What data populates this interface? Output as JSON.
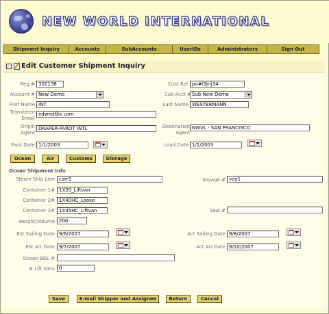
{
  "header": {
    "company_name": "NEW WORLD INTERNATIONAL"
  },
  "nav": [
    {
      "label": "Shipment Inquiry"
    },
    {
      "label": "Accounts"
    },
    {
      "label": "SubAccounts"
    },
    {
      "label": "UserIDs"
    },
    {
      "label": "Administrators"
    },
    {
      "label": "Sign Out"
    }
  ],
  "panel": {
    "collapse_symbol": "–",
    "title": "Edit Customer Shipment Inquiry"
  },
  "form": {
    "reg_label": "Reg #",
    "reg_value": "302138",
    "cust_ref_label": "Cust Ref #",
    "cust_ref_value": "po#i3jrij34",
    "account_label": "Account #",
    "account_value": "New Demo",
    "sub_acct_label": "Sub Acct #",
    "sub_acct_value": "Sub New Demo",
    "first_name_label": "First Name",
    "first_name_value": "INT",
    "last_name_label": "Last Name",
    "last_name_value": "WESTERMANN",
    "transferee_email_label": "Transferee Email",
    "transferee_email_value": "edwed@x.com",
    "origin_agent_label": "Origin Agent",
    "origin_agent_value": "DRAPER-PAROT INTL",
    "destination_agent_label": "Destination Agent",
    "destination_agent_value": "NWVL - SAN FRANCISCO",
    "pack_date_label": "Pack Date",
    "pack_date_value": "1/1/2003",
    "load_date_label": "Load Date",
    "load_date_value": "1/1/2003"
  },
  "mode_buttons": {
    "ocean": "Ocean",
    "air": "Air",
    "customs": "Customs",
    "storage": "Storage"
  },
  "ocean": {
    "section_title": "Ocean Shipment Info",
    "steam_ship_line_label": "Steam Ship Line",
    "steam_ship_line_value": "carr1",
    "voyage_label": "Voyage #",
    "voyage_value": "voy1",
    "container1_label": "Container 1#",
    "container1_value": "1X20_Liftvan",
    "container2_label": "Container 2#",
    "container2_value": "1X40HC_Loose",
    "container3_label": "Container 3#",
    "container3_value": "1X45HC_Liftvan",
    "seal_label": "Seal #",
    "seal_value": "",
    "weight_volume_label": "Weight/Volume",
    "weight_volume_value": "200",
    "est_sailing_label": "Est Sailing Date",
    "est_sailing_value": "9/6/2007",
    "act_sailing_label": "Act Sailing Date",
    "act_sailing_value": "9/8/2007",
    "est_arr_label": "Est Arr Date",
    "est_arr_value": "9/7/2007",
    "act_arr_label": "Act Arr Date",
    "act_arr_value": "9/10/2007",
    "ocean_bol_label": "Ocean BOL #",
    "ocean_bol_value": "",
    "lift_vans_label": "# Lift Vans",
    "lift_vans_value": "0"
  },
  "actions": {
    "save": "Save",
    "email": "E-mail Shipper and Assignee",
    "return": "Return",
    "cancel": "Cancel"
  }
}
